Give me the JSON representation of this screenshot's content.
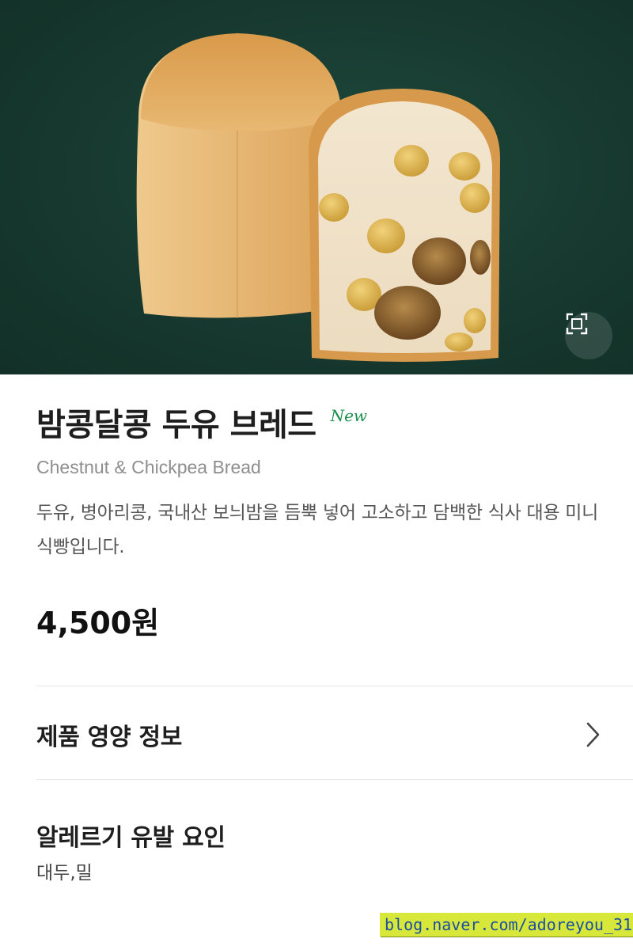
{
  "product": {
    "name_ko": "밤콩달콩 두유 브레드",
    "badge": "New",
    "name_en": "Chestnut & Chickpea Bread",
    "description": "두유, 병아리콩, 국내산 보늬밤을 듬뿍 넣어 고소하고 담백한 식사 대용 미니 식빵입니다.",
    "price": "4,500원"
  },
  "sections": {
    "nutrition_label": "제품 영양 정보",
    "allergy_label": "알레르기 유발 요인",
    "allergy_value": "대두,밀"
  },
  "watermark": "blog.naver.com/adoreyou_31",
  "colors": {
    "hero_background": "#17392f",
    "badge_green": "#1a8f4c",
    "watermark_bg": "#d7e83a",
    "watermark_text": "#1c4fa0"
  },
  "icons": {
    "expand": "expand-icon",
    "chevron": "chevron-right-icon"
  }
}
